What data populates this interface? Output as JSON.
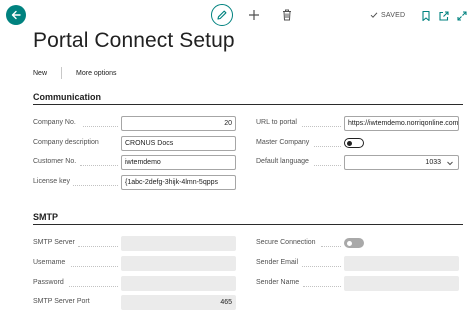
{
  "header": {
    "icons": [
      "back-arrow-icon",
      "pencil-icon",
      "plus-icon",
      "trash-icon",
      "checkmark-icon",
      "bookmark-icon",
      "open-new-window-icon",
      "expand-icon"
    ],
    "saved_label": "SAVED",
    "accent_color": "#00827f"
  },
  "page": {
    "title": "Portal Connect Setup"
  },
  "actions": {
    "new_label": "New",
    "more_options_label": "More options"
  },
  "communication": {
    "title": "Communication",
    "company_no": {
      "label": "Company No.",
      "value": "20"
    },
    "company_description": {
      "label": "Company description",
      "value": "CRONUS Docs"
    },
    "customer_no": {
      "label": "Customer No.",
      "value": "iwtemdemo"
    },
    "license_key": {
      "label": "License key",
      "value": "{1abc-2defg-3hijk-4lmn-5qpps"
    },
    "url_to_portal": {
      "label": "URL to portal",
      "value": "https://iwtemdemo.norriqonline.com"
    },
    "master_company": {
      "label": "Master Company",
      "value": false
    },
    "default_language": {
      "label": "Default language",
      "value": "1033"
    }
  },
  "smtp": {
    "title": "SMTP",
    "server": {
      "label": "SMTP Server",
      "value": ""
    },
    "username": {
      "label": "Username",
      "value": ""
    },
    "password": {
      "label": "Password",
      "value": ""
    },
    "port": {
      "label": "SMTP Server Port",
      "value": "465"
    },
    "secure_connection": {
      "label": "Secure Connection",
      "value": false
    },
    "sender_email": {
      "label": "Sender Email",
      "value": ""
    },
    "sender_name": {
      "label": "Sender Name",
      "value": ""
    }
  }
}
